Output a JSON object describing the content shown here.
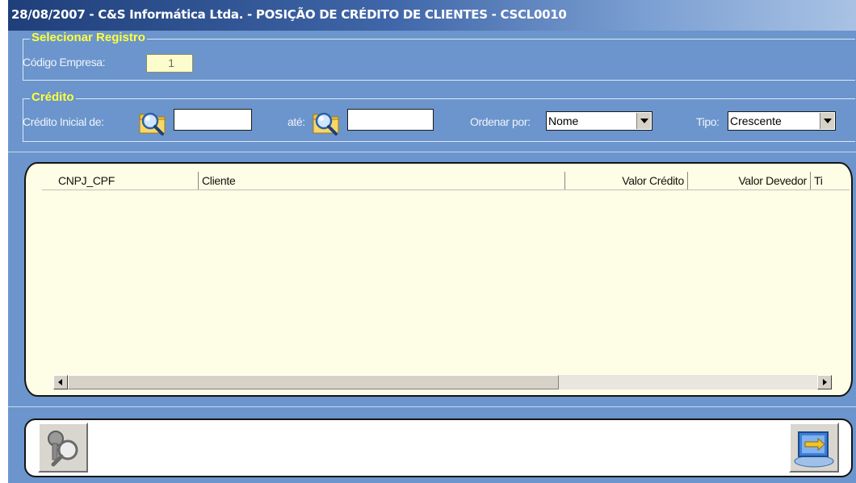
{
  "window": {
    "title": "28/08/2007  - C&S Informática Ltda. - POSIÇÃO DE CRÉDITO DE CLIENTES  - CSCL0010"
  },
  "selecionar": {
    "legend": "Selecionar Registro",
    "codigo_label": "Código Empresa:",
    "codigo_value": "1"
  },
  "credito": {
    "legend": "Crédito",
    "inicial_label": "Crédito Inicial de:",
    "inicial_value": "",
    "ate_label": "até:",
    "ate_value": "",
    "ordenar_label": "Ordenar por:",
    "ordenar_value": "Nome",
    "tipo_label": "Tipo:",
    "tipo_value": "Crescente"
  },
  "grid": {
    "columns": [
      "CNPJ_CPF",
      "Cliente",
      "Valor Crédito",
      "Valor Devedor",
      "Ti"
    ],
    "rows": []
  },
  "icons": {
    "search_left": "folder-search-icon",
    "search_right": "folder-search-icon",
    "query_button": "key-magnifier-icon",
    "exit_button": "exit-door-icon"
  },
  "colors": {
    "window_bg": "#6b95cc",
    "legend": "#ffff3c",
    "grid_bg": "#fefde5",
    "code_field_bg": "#fdfccc"
  }
}
